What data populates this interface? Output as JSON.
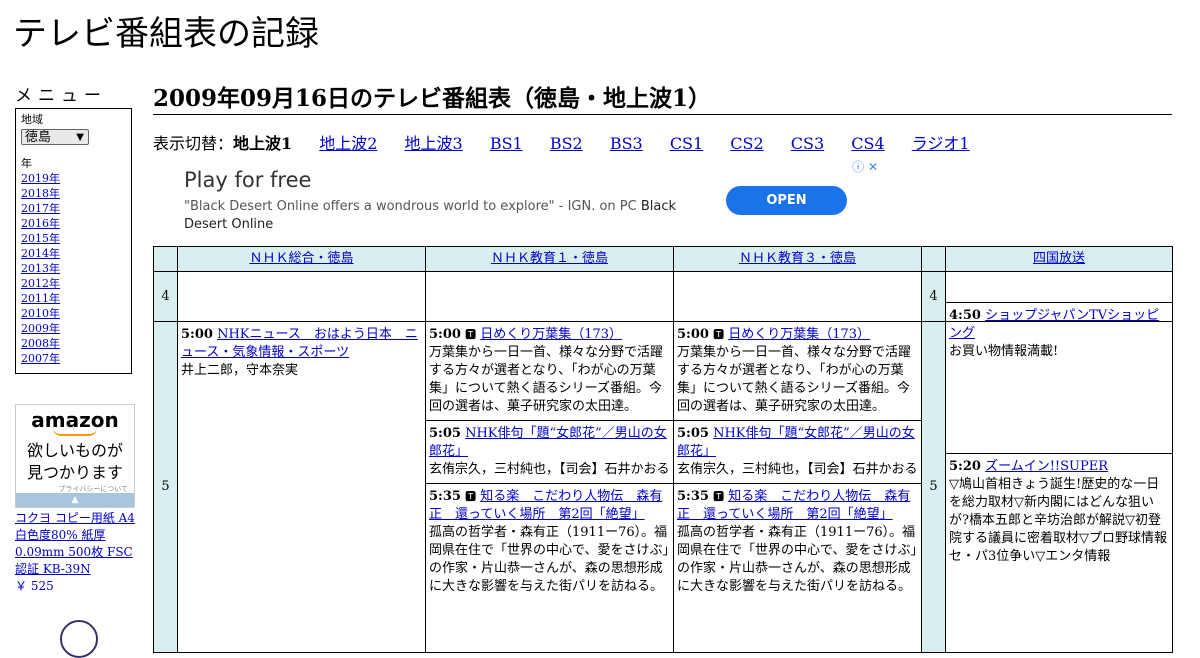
{
  "site": {
    "title": "テレビ番組表の記録"
  },
  "menu": {
    "title": "メニュー",
    "region_label": "地域",
    "region_selected": "徳島",
    "year_label": "年",
    "years": [
      "2019年",
      "2018年",
      "2017年",
      "2016年",
      "2015年",
      "2014年",
      "2013年",
      "2012年",
      "2011年",
      "2010年",
      "2009年",
      "2008年",
      "2007年"
    ]
  },
  "amazon_ad": {
    "logo": "amazon",
    "copy_line1": "欲しいものが",
    "copy_line2": "見つかります",
    "privacy": "プライバシーについて",
    "product": "コクヨ コピー用紙 A4 白色度80% 紙厚 0.09mm 500枚 FSC認証 KB-39N",
    "price": "￥ 525"
  },
  "page": {
    "heading": "2009年09月16日のテレビ番組表（徳島・地上波1）",
    "switch_label": "表示切替：",
    "switch_current": "地上波1",
    "switch_links": [
      "地上波2",
      "地上波3",
      "BS1",
      "BS2",
      "BS3",
      "CS1",
      "CS2",
      "CS3",
      "CS4",
      "ラジオ1"
    ]
  },
  "ad": {
    "title": "Play for free",
    "desc": "\"Black Desert Online offers a wondrous world to explore\" - IGN. on PC",
    "desc_bold": "Black Desert Online",
    "button": "OPEN",
    "icons": "ⓘ ✕"
  },
  "grid": {
    "channels": [
      "ＮＨＫ総合・徳島",
      "ＮＨＫ教育１・徳島",
      "ＮＨＫ教育３・徳島",
      "四国放送"
    ],
    "hours": [
      "4",
      "5"
    ],
    "nhk_sogo": {
      "p1_time": "5:00",
      "p1_title": "NHKニュース　おはよう日本　ニュース・気象情報・スポーツ",
      "p1_desc": "井上二郎，守本奈実"
    },
    "edu1": {
      "p1_time": "5:00",
      "p1_title": "日めくり万葉集（173）",
      "p1_desc": "万葉集から一日一首、様々な分野で活躍する方々が選者となり、「わが心の万葉集」について熱く語るシリーズ番組。今回の選者は、菓子研究家の太田達。",
      "p2_time": "5:05",
      "p2_title": "NHK俳句「題“女郎花”／男山の女郎花」",
      "p2_desc": "玄侑宗久，三村純也，【司会】石井かおる",
      "p3_time": "5:35",
      "p3_title": "知る楽　こだわり人物伝　森有正　還っていく場所　第2回「絶望」",
      "p3_desc": "孤高の哲学者・森有正（1911ー76）。福岡県在住で「世界の中心で、愛をさけぶ」の作家・片山恭一さんが、森の思想形成に大きな影響を与えた街パリを訪ねる。"
    },
    "edu3": {
      "p1_time": "5:00",
      "p1_title": "日めくり万葉集（173）",
      "p1_desc": "万葉集から一日一首、様々な分野で活躍する方々が選者となり、「わが心の万葉集」について熱く語るシリーズ番組。今回の選者は、菓子研究家の太田達。",
      "p2_time": "5:05",
      "p2_title": "NHK俳句「題“女郎花”／男山の女郎花」",
      "p2_desc": "玄侑宗久，三村純也，【司会】石井かおる",
      "p3_time": "5:35",
      "p3_title": "知る楽　こだわり人物伝　森有正　還っていく場所　第2回「絶望」",
      "p3_desc": "孤高の哲学者・森有正（1911ー76）。福岡県在住で「世界の中心で、愛をさけぶ」の作家・片山恭一さんが、森の思想形成に大きな影響を与えた街パリを訪ねる。"
    },
    "shikoku": {
      "p1_time": "4:50",
      "p1_title": "ショップジャパンTVショッピング",
      "p1_desc": "お買い物情報満載!",
      "p2_time": "5:20",
      "p2_title": "ズームイン!!SUPER",
      "p2_desc": "▽鳩山首相きょう誕生!歴史的な一日を総力取材▽新内閣にはどんな狙いが?橋本五郎と辛坊治郎が解説▽初登院する議員に密着取材▽プロ野球情報セ・パ3位争い▽エンタ情報"
    },
    "tv_icon": "🆃"
  }
}
